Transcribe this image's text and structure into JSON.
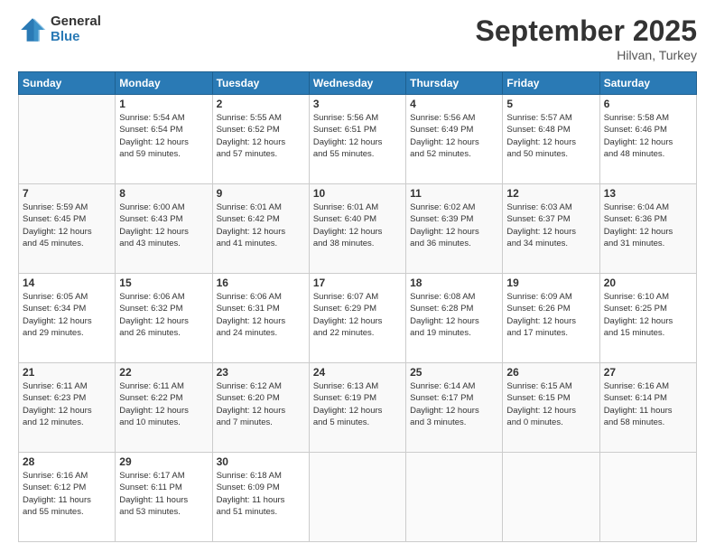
{
  "logo": {
    "general": "General",
    "blue": "Blue"
  },
  "header": {
    "title": "September 2025",
    "subtitle": "Hilvan, Turkey"
  },
  "weekdays": [
    "Sunday",
    "Monday",
    "Tuesday",
    "Wednesday",
    "Thursday",
    "Friday",
    "Saturday"
  ],
  "weeks": [
    [
      {
        "day": "",
        "info": ""
      },
      {
        "day": "1",
        "info": "Sunrise: 5:54 AM\nSunset: 6:54 PM\nDaylight: 12 hours\nand 59 minutes."
      },
      {
        "day": "2",
        "info": "Sunrise: 5:55 AM\nSunset: 6:52 PM\nDaylight: 12 hours\nand 57 minutes."
      },
      {
        "day": "3",
        "info": "Sunrise: 5:56 AM\nSunset: 6:51 PM\nDaylight: 12 hours\nand 55 minutes."
      },
      {
        "day": "4",
        "info": "Sunrise: 5:56 AM\nSunset: 6:49 PM\nDaylight: 12 hours\nand 52 minutes."
      },
      {
        "day": "5",
        "info": "Sunrise: 5:57 AM\nSunset: 6:48 PM\nDaylight: 12 hours\nand 50 minutes."
      },
      {
        "day": "6",
        "info": "Sunrise: 5:58 AM\nSunset: 6:46 PM\nDaylight: 12 hours\nand 48 minutes."
      }
    ],
    [
      {
        "day": "7",
        "info": "Sunrise: 5:59 AM\nSunset: 6:45 PM\nDaylight: 12 hours\nand 45 minutes."
      },
      {
        "day": "8",
        "info": "Sunrise: 6:00 AM\nSunset: 6:43 PM\nDaylight: 12 hours\nand 43 minutes."
      },
      {
        "day": "9",
        "info": "Sunrise: 6:01 AM\nSunset: 6:42 PM\nDaylight: 12 hours\nand 41 minutes."
      },
      {
        "day": "10",
        "info": "Sunrise: 6:01 AM\nSunset: 6:40 PM\nDaylight: 12 hours\nand 38 minutes."
      },
      {
        "day": "11",
        "info": "Sunrise: 6:02 AM\nSunset: 6:39 PM\nDaylight: 12 hours\nand 36 minutes."
      },
      {
        "day": "12",
        "info": "Sunrise: 6:03 AM\nSunset: 6:37 PM\nDaylight: 12 hours\nand 34 minutes."
      },
      {
        "day": "13",
        "info": "Sunrise: 6:04 AM\nSunset: 6:36 PM\nDaylight: 12 hours\nand 31 minutes."
      }
    ],
    [
      {
        "day": "14",
        "info": "Sunrise: 6:05 AM\nSunset: 6:34 PM\nDaylight: 12 hours\nand 29 minutes."
      },
      {
        "day": "15",
        "info": "Sunrise: 6:06 AM\nSunset: 6:32 PM\nDaylight: 12 hours\nand 26 minutes."
      },
      {
        "day": "16",
        "info": "Sunrise: 6:06 AM\nSunset: 6:31 PM\nDaylight: 12 hours\nand 24 minutes."
      },
      {
        "day": "17",
        "info": "Sunrise: 6:07 AM\nSunset: 6:29 PM\nDaylight: 12 hours\nand 22 minutes."
      },
      {
        "day": "18",
        "info": "Sunrise: 6:08 AM\nSunset: 6:28 PM\nDaylight: 12 hours\nand 19 minutes."
      },
      {
        "day": "19",
        "info": "Sunrise: 6:09 AM\nSunset: 6:26 PM\nDaylight: 12 hours\nand 17 minutes."
      },
      {
        "day": "20",
        "info": "Sunrise: 6:10 AM\nSunset: 6:25 PM\nDaylight: 12 hours\nand 15 minutes."
      }
    ],
    [
      {
        "day": "21",
        "info": "Sunrise: 6:11 AM\nSunset: 6:23 PM\nDaylight: 12 hours\nand 12 minutes."
      },
      {
        "day": "22",
        "info": "Sunrise: 6:11 AM\nSunset: 6:22 PM\nDaylight: 12 hours\nand 10 minutes."
      },
      {
        "day": "23",
        "info": "Sunrise: 6:12 AM\nSunset: 6:20 PM\nDaylight: 12 hours\nand 7 minutes."
      },
      {
        "day": "24",
        "info": "Sunrise: 6:13 AM\nSunset: 6:19 PM\nDaylight: 12 hours\nand 5 minutes."
      },
      {
        "day": "25",
        "info": "Sunrise: 6:14 AM\nSunset: 6:17 PM\nDaylight: 12 hours\nand 3 minutes."
      },
      {
        "day": "26",
        "info": "Sunrise: 6:15 AM\nSunset: 6:15 PM\nDaylight: 12 hours\nand 0 minutes."
      },
      {
        "day": "27",
        "info": "Sunrise: 6:16 AM\nSunset: 6:14 PM\nDaylight: 11 hours\nand 58 minutes."
      }
    ],
    [
      {
        "day": "28",
        "info": "Sunrise: 6:16 AM\nSunset: 6:12 PM\nDaylight: 11 hours\nand 55 minutes."
      },
      {
        "day": "29",
        "info": "Sunrise: 6:17 AM\nSunset: 6:11 PM\nDaylight: 11 hours\nand 53 minutes."
      },
      {
        "day": "30",
        "info": "Sunrise: 6:18 AM\nSunset: 6:09 PM\nDaylight: 11 hours\nand 51 minutes."
      },
      {
        "day": "",
        "info": ""
      },
      {
        "day": "",
        "info": ""
      },
      {
        "day": "",
        "info": ""
      },
      {
        "day": "",
        "info": ""
      }
    ]
  ]
}
